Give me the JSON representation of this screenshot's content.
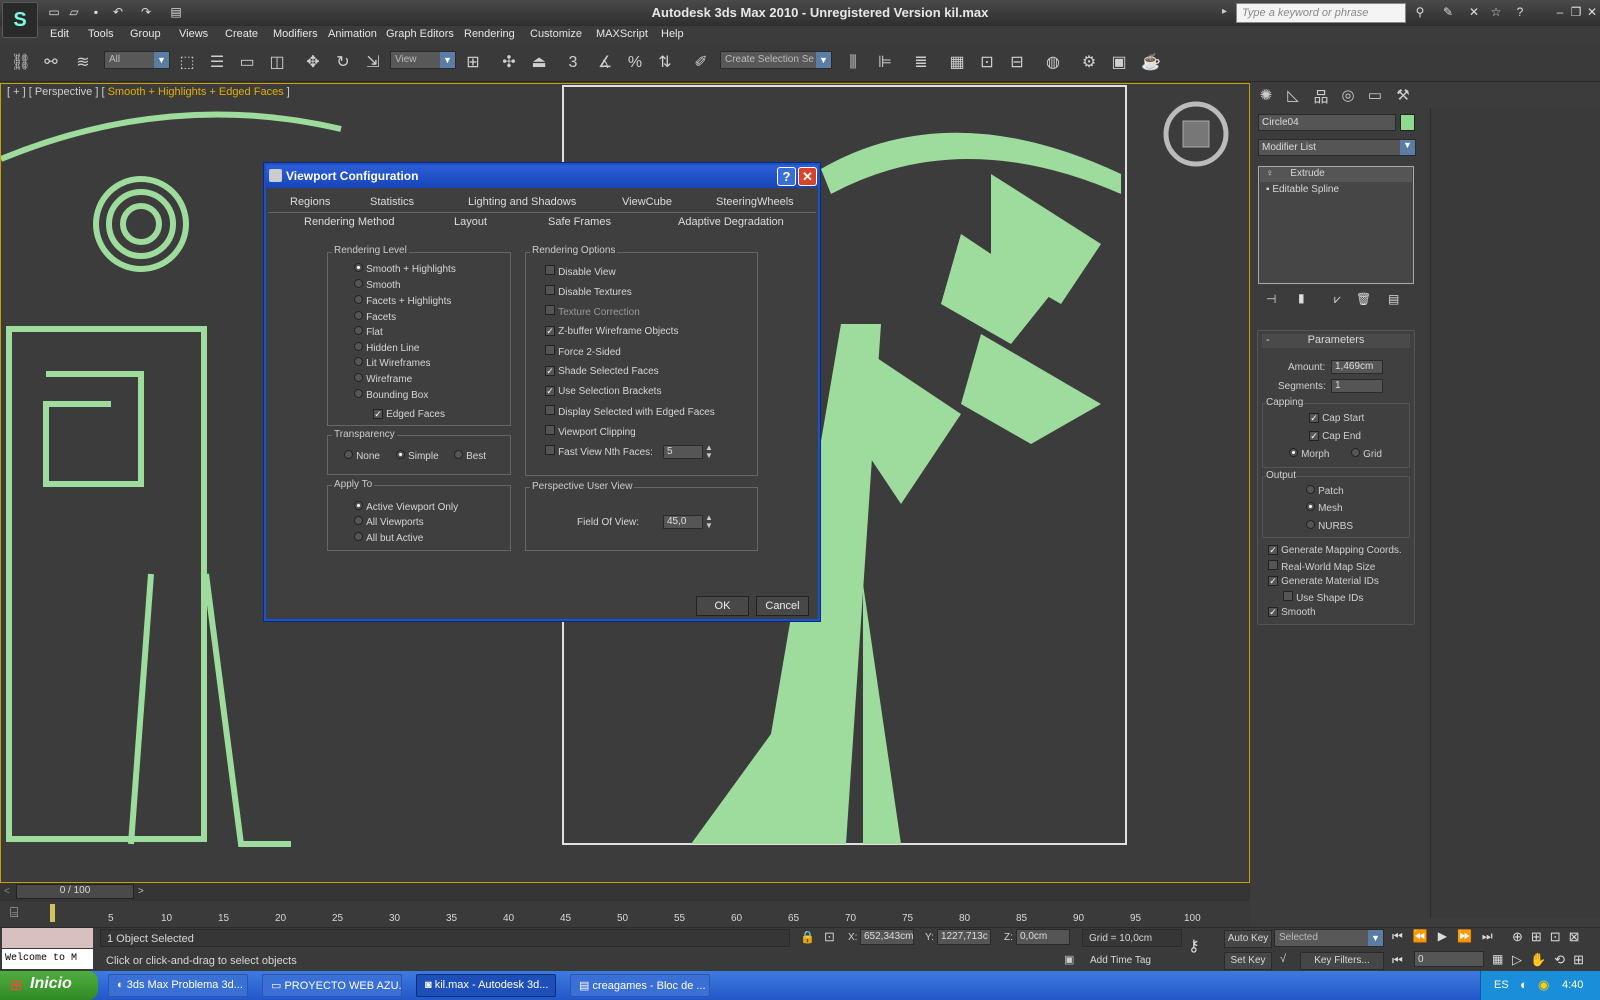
{
  "window": {
    "title": "Autodesk 3ds Max  2010   - Unregistered Version    kil.max",
    "search_placeholder": "Type a keyword or phrase"
  },
  "menu": [
    "Edit",
    "Tools",
    "Group",
    "Views",
    "Create",
    "Modifiers",
    "Animation",
    "Graph Editors",
    "Rendering",
    "Customize",
    "MAXScript",
    "Help"
  ],
  "toolbar": {
    "selection_filter": "All",
    "ref_coord": "View",
    "named_selection": "Create Selection Se",
    "snaps_label": "3"
  },
  "viewport": {
    "label_prefix": "[ + ] [ Perspective ] [ ",
    "label_mode": "Smooth + Highlights + Edged Faces",
    "label_suffix": " ]",
    "accent": "#9edc9e"
  },
  "dialog": {
    "title": "Viewport Configuration",
    "tabs_row1": [
      "Regions",
      "Statistics",
      "Lighting and Shadows",
      "ViewCube",
      "SteeringWheels"
    ],
    "tabs_row2": [
      "Rendering Method",
      "Layout",
      "Safe Frames",
      "Adaptive Degradation"
    ],
    "rendering_level": {
      "label": "Rendering Level",
      "options": [
        "Smooth + Highlights",
        "Smooth",
        "Facets + Highlights",
        "Facets",
        "Flat",
        "Hidden Line",
        "Lit Wireframes",
        "Wireframe",
        "Bounding Box"
      ],
      "selected": "Smooth + Highlights",
      "edged_faces": "Edged Faces"
    },
    "transparency": {
      "label": "Transparency",
      "options": [
        "None",
        "Simple",
        "Best"
      ],
      "selected": "Simple"
    },
    "apply_to": {
      "label": "Apply To",
      "options": [
        "Active Viewport Only",
        "All Viewports",
        "All but Active"
      ],
      "selected": "Active Viewport Only"
    },
    "rendering_options": {
      "label": "Rendering Options",
      "items": [
        {
          "label": "Disable View",
          "checked": false
        },
        {
          "label": "Disable Textures",
          "checked": false
        },
        {
          "label": "Texture Correction",
          "checked": false
        },
        {
          "label": "Z-buffer Wireframe Objects",
          "checked": true
        },
        {
          "label": "Force 2-Sided",
          "checked": false
        },
        {
          "label": "Shade Selected Faces",
          "checked": true
        },
        {
          "label": "Use Selection Brackets",
          "checked": true
        },
        {
          "label": "Display Selected with Edged Faces",
          "checked": false
        },
        {
          "label": "Viewport Clipping",
          "checked": false
        },
        {
          "label": "Fast View Nth Faces:",
          "checked": false
        }
      ],
      "nth_faces_value": "5"
    },
    "perspective": {
      "label": "Perspective User View",
      "fov_label": "Field Of View:",
      "fov_value": "45,0"
    },
    "ok": "OK",
    "cancel": "Cancel"
  },
  "command_panel": {
    "object_name": "Circle04",
    "object_color": "#8fd88f",
    "modifier_list": "Modifier List",
    "stack": [
      "Extrude",
      "Editable Spline"
    ],
    "params": {
      "title": "Parameters",
      "amount_label": "Amount:",
      "amount": "1,469cm",
      "segments_label": "Segments:",
      "segments": "1",
      "capping": "Capping",
      "cap_start": "Cap Start",
      "cap_end": "Cap End",
      "morph": "Morph",
      "grid": "Grid",
      "output": "Output",
      "patch": "Patch",
      "mesh": "Mesh",
      "nurbs": "NURBS",
      "gen_mapping": "Generate Mapping Coords.",
      "real_world": "Real-World Map Size",
      "gen_mat": "Generate Material IDs",
      "use_shape": "Use Shape IDs",
      "smooth": "Smooth"
    }
  },
  "timeline": {
    "frame": "0 / 100",
    "ticks": [
      "5",
      "10",
      "15",
      "20",
      "25",
      "30",
      "35",
      "40",
      "45",
      "50",
      "55",
      "60",
      "65",
      "70",
      "75",
      "80",
      "85",
      "90",
      "95",
      "100"
    ]
  },
  "status": {
    "selected": "1 Object Selected",
    "prompt": "Click or click-and-drag to select objects",
    "welcome": "Welcome to M",
    "x_label": "X:",
    "x": "652,343cm",
    "y_label": "Y:",
    "y": "1227,713c",
    "z_label": "Z:",
    "z": "0,0cm",
    "grid": "Grid = 10,0cm",
    "add_time_tag": "Add Time Tag",
    "auto_key": "Auto Key",
    "set_key": "Set Key",
    "selected_combo": "Selected",
    "key_filters": "Key Filters...",
    "frame_value": "0"
  },
  "taskbar": {
    "start": "Inicio",
    "tasks": [
      "3ds Max Problema 3d...",
      "PROYECTO WEB AZU...",
      "kil.max - Autodesk 3d...",
      "creagames - Bloc de ..."
    ],
    "lang": "ES",
    "clock": "4:40"
  }
}
